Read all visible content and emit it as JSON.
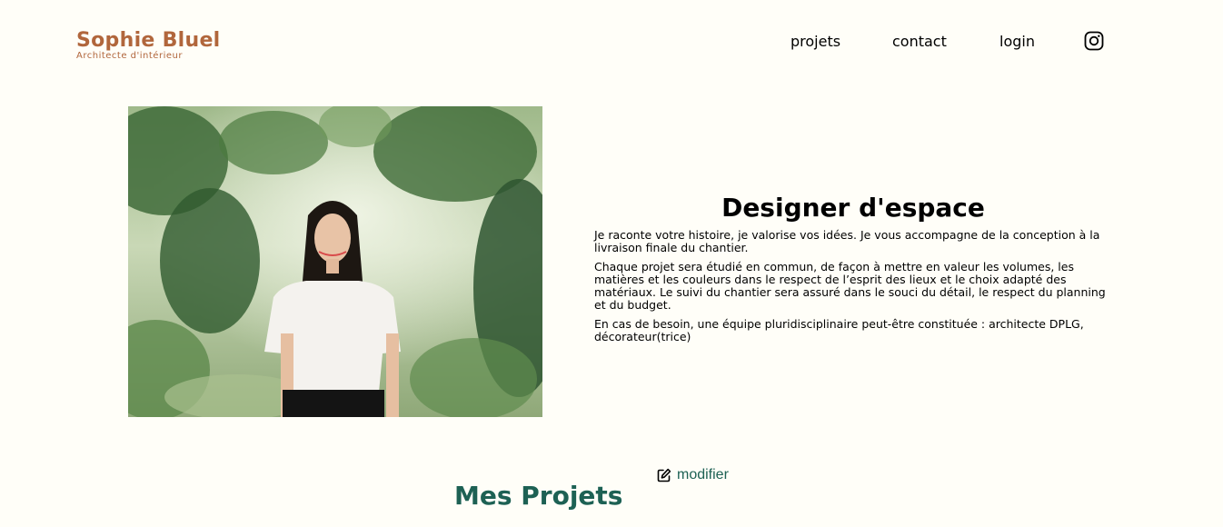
{
  "header": {
    "logo_title": "Sophie Bluel",
    "logo_subtitle": "Architecte d'intérieur",
    "nav": {
      "projets": "projets",
      "contact": "contact",
      "login": "login",
      "instagram_icon": "instagram-icon"
    }
  },
  "intro": {
    "photo_icon": "portrait-photo",
    "title": "Designer d'espace",
    "paragraphs": [
      "Je raconte votre histoire, je valorise vos idées. Je vous accompagne de la conception à la livraison finale du chantier.",
      "Chaque projet sera étudié en commun, de façon à mettre en valeur les volumes, les matières et les couleurs dans le respect de l’esprit des lieux et le choix adapté des matériaux. Le suivi du chantier sera assuré dans le souci du détail, le respect du planning et du budget.",
      "En cas de besoin, une équipe pluridisciplinaire peut-être constituée : architecte DPLG, décorateur(trice)"
    ]
  },
  "projects": {
    "title": "Mes Projets",
    "modify_label": "modifier",
    "modify_icon": "edit-icon"
  },
  "colors": {
    "background": "#FFFEF8",
    "brand": "#B1663C",
    "accent": "#1D6154"
  }
}
